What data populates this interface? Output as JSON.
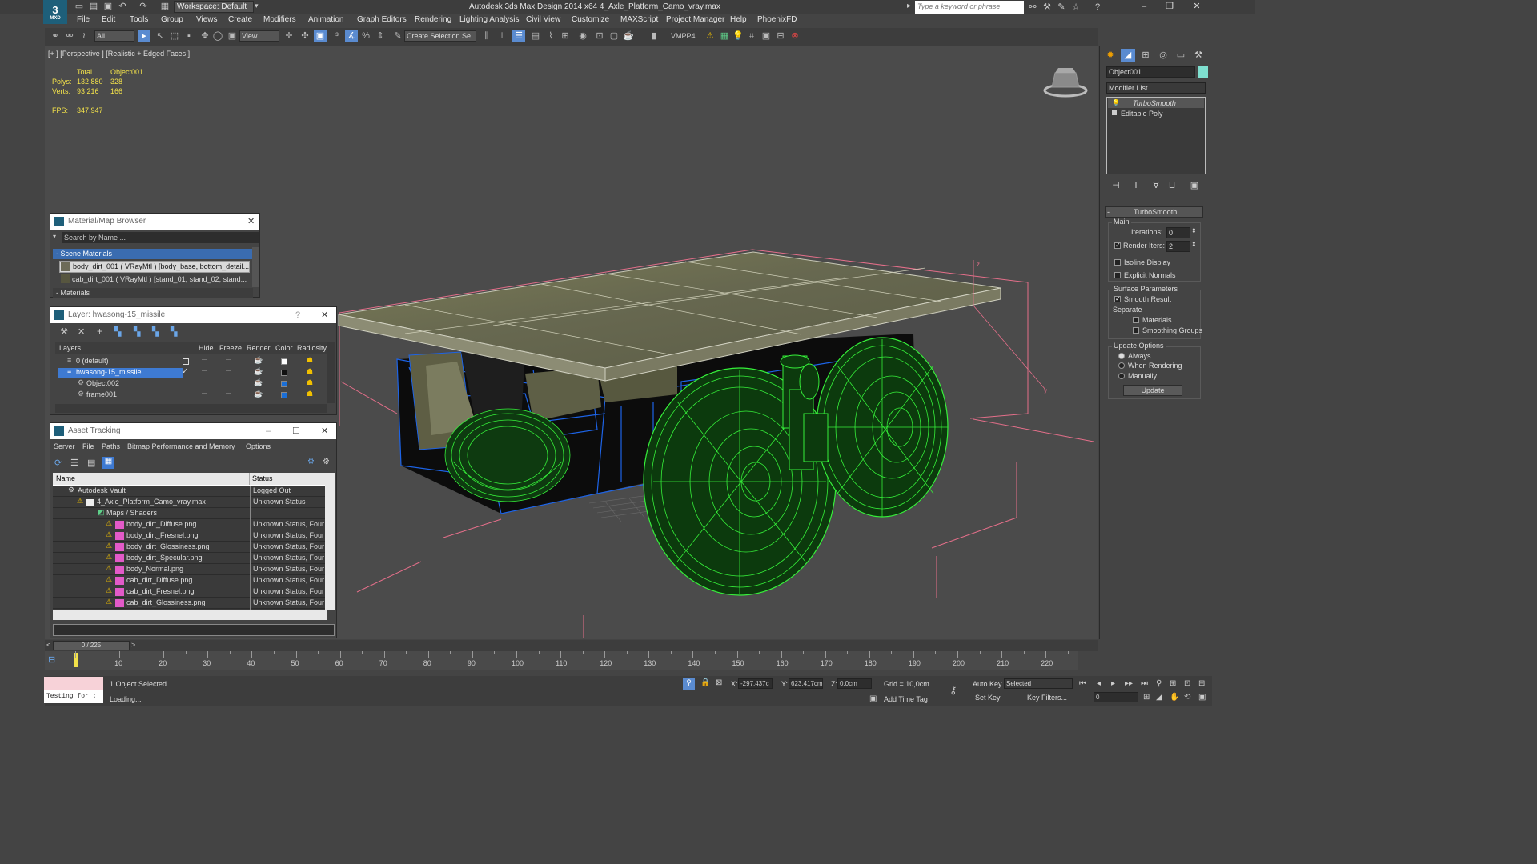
{
  "window": {
    "title": "Autodesk 3ds Max Design 2014 x64     4_Axle_Platform_Camo_vray.max",
    "workspace": "Workspace: Default",
    "search_placeholder": "Type a keyword or phrase",
    "logo_label": "MXD"
  },
  "menubar": [
    "File",
    "Edit",
    "Tools",
    "Group",
    "Views",
    "Create",
    "Modifiers",
    "Animation",
    "Graph Editors",
    "Rendering",
    "Lighting Analysis",
    "Civil View",
    "Customize",
    "MAXScript",
    "Project Manager",
    "Help",
    "PhoenixFD"
  ],
  "toolbar": {
    "filter": "All",
    "ref_coord": "View",
    "selection_set": "Create Selection Se",
    "vmpp": "VMPP4"
  },
  "viewport": {
    "label": "[+ ] [Perspective ] [Realistic + Edged Faces ]",
    "stats": {
      "col_total": "Total",
      "col_object": "Object001",
      "polys_label": "Polys:",
      "polys_total": "132 880",
      "polys_object": "328",
      "verts_label": "Verts:",
      "verts_total": "93 216",
      "verts_object": "166",
      "fps_label": "FPS:",
      "fps_value": "347,947"
    },
    "gizmo_z": "z",
    "gizmo_y": "y"
  },
  "command_panel": {
    "object_name": "Object001",
    "object_color": "#7fe0d0",
    "modifier_list": "Modifier List",
    "stack": [
      "TurboSmooth",
      "Editable Poly"
    ],
    "rollout_title": "TurboSmooth",
    "main_label": "Main",
    "iterations_label": "Iterations:",
    "iterations_value": "0",
    "render_iters_label": "Render Iters:",
    "render_iters_value": "2",
    "isoline": "Isoline Display",
    "explicit_normals": "Explicit Normals",
    "surface_params": "Surface Parameters",
    "smooth_result": "Smooth Result",
    "separate": "Separate",
    "materials": "Materials",
    "smoothing_groups": "Smoothing Groups",
    "update_options": "Update Options",
    "always": "Always",
    "when_rendering": "When Rendering",
    "manually": "Manually",
    "update_button": "Update"
  },
  "material_browser": {
    "title": "Material/Map Browser",
    "search_placeholder": "Search by Name ...",
    "section_scene": "- Scene Materials",
    "items": [
      "body_dirt_001  ( VRayMtl ) [body_base, bottom_detail...",
      "cab_dirt_001  ( VRayMtl ) [stand_01, stand_02, stand..."
    ],
    "section_materials": "- Materials"
  },
  "layer_panel": {
    "title": "Layer: hwasong-15_missile",
    "help": "?",
    "columns": [
      "Layers",
      "Hide",
      "Freeze",
      "Render",
      "Color",
      "Radiosity"
    ],
    "rows": [
      {
        "name": "0 (default)",
        "color": "#ffffff"
      },
      {
        "name": "hwasong-15_missile",
        "color": "#111111"
      },
      {
        "name": "Object002",
        "color": "#1a6fd8"
      },
      {
        "name": "frame001",
        "color": "#1a6fd8"
      }
    ]
  },
  "asset_tracking": {
    "title": "Asset Tracking",
    "menu": [
      "Server",
      "File",
      "Paths",
      "Bitmap Performance and Memory",
      "Options"
    ],
    "col_name": "Name",
    "col_status": "Status",
    "rows": [
      {
        "name": "Autodesk Vault",
        "status": "Logged Out"
      },
      {
        "name": "4_Axle_Platform_Camo_vray.max",
        "status": "Unknown Status"
      },
      {
        "name": "Maps / Shaders",
        "status": ""
      },
      {
        "name": "body_dirt_Diffuse.png",
        "status": "Unknown Status, Four"
      },
      {
        "name": "body_dirt_Fresnel.png",
        "status": "Unknown Status, Four"
      },
      {
        "name": "body_dirt_Glossiness.png",
        "status": "Unknown Status, Four"
      },
      {
        "name": "body_dirt_Specular.png",
        "status": "Unknown Status, Four"
      },
      {
        "name": "body_Normal.png",
        "status": "Unknown Status, Four"
      },
      {
        "name": "cab_dirt_Diffuse.png",
        "status": "Unknown Status, Four"
      },
      {
        "name": "cab_dirt_Fresnel.png",
        "status": "Unknown Status, Four"
      },
      {
        "name": "cab_dirt_Glossiness.png",
        "status": "Unknown Status, Four"
      }
    ]
  },
  "timeline": {
    "frame_counter": "0 / 225",
    "ticks": [
      "10",
      "20",
      "30",
      "40",
      "50",
      "60",
      "70",
      "80",
      "90",
      "100",
      "110",
      "120",
      "130",
      "140",
      "150",
      "160",
      "170",
      "180",
      "190",
      "200",
      "210",
      "220"
    ]
  },
  "statusbar": {
    "script_text": "Testing for :",
    "selection": "1 Object Selected",
    "loading": "Loading...",
    "x_label": "X:",
    "x_value": "-297,437c",
    "y_label": "Y:",
    "y_value": "623,417cm",
    "z_label": "Z:",
    "z_value": "0,0cm",
    "grid": "Grid = 10,0cm",
    "add_time_tag": "Add Time Tag",
    "auto_key": "Auto Key",
    "set_key": "Set Key",
    "key_mode": "Selected",
    "key_filters": "Key Filters...",
    "frame_value": "0"
  }
}
